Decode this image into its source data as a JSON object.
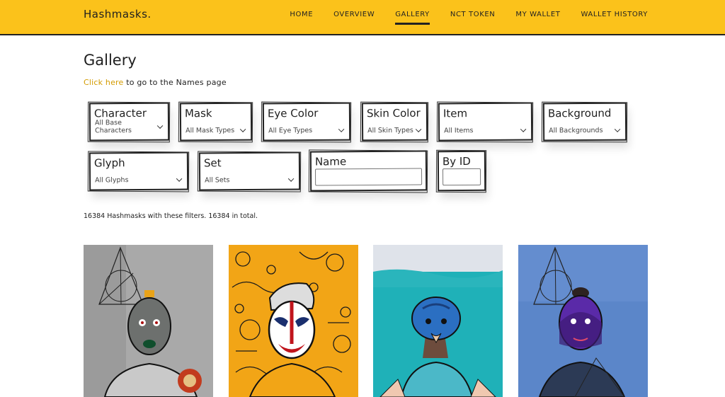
{
  "header": {
    "brand": "Hashmasks.",
    "nav": [
      "HOME",
      "OVERVIEW",
      "GALLERY",
      "NCT TOKEN",
      "MY WALLET",
      "WALLET HISTORY"
    ],
    "active_nav": "GALLERY"
  },
  "page": {
    "title": "Gallery",
    "names_link": "Click here",
    "names_text": " to go to the Names page"
  },
  "filters": {
    "character": {
      "label": "Character",
      "value": "All Base Characters"
    },
    "mask": {
      "label": "Mask",
      "value": "All Mask Types"
    },
    "eye_color": {
      "label": "Eye Color",
      "value": "All Eye Types"
    },
    "skin_color": {
      "label": "Skin Color",
      "value": "All Skin Types"
    },
    "item": {
      "label": "Item",
      "value": "All Items"
    },
    "background": {
      "label": "Background",
      "value": "All Backgrounds"
    },
    "glyph": {
      "label": "Glyph",
      "value": "All Glyphs"
    },
    "set": {
      "label": "Set",
      "value": "All Sets"
    },
    "name": {
      "label": "Name",
      "value": ""
    },
    "by_id": {
      "label": "By ID",
      "value": ""
    }
  },
  "results": {
    "summary": "16384 Hashmasks with these filters. 16384 in total."
  },
  "colors": {
    "header_bg": "#fbc21b",
    "link": "#d39b00",
    "tile2_bg": "#f2a516",
    "tile3_bg": "#1fb1b8",
    "tile4_bg": "#5b86c9"
  }
}
